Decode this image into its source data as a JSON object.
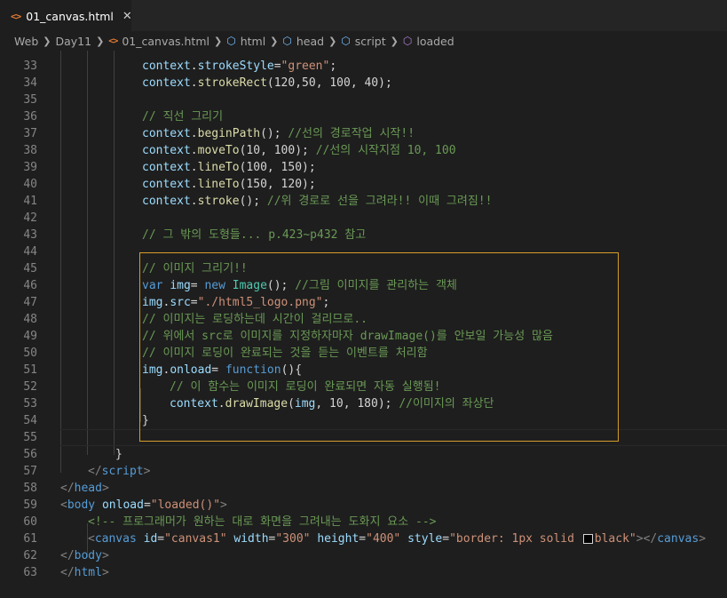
{
  "tab": {
    "icon": "<>",
    "label": "01_canvas.html",
    "close": "✕"
  },
  "breadcrumb": {
    "items": [
      {
        "label": "Web",
        "icon": ""
      },
      {
        "label": "Day11",
        "icon": ""
      },
      {
        "label": "01_canvas.html",
        "icon": "html-icon"
      },
      {
        "label": "html",
        "icon": "cube-icon"
      },
      {
        "label": "head",
        "icon": "cube-icon"
      },
      {
        "label": "script",
        "icon": "cube-icon"
      },
      {
        "label": "loaded",
        "icon": "purple-cube-icon"
      }
    ]
  },
  "editor": {
    "line_numbers": [
      "33",
      "34",
      "35",
      "36",
      "37",
      "38",
      "39",
      "40",
      "41",
      "42",
      "43",
      "44",
      "45",
      "46",
      "47",
      "48",
      "49",
      "50",
      "51",
      "52",
      "53",
      "54",
      "55",
      "56",
      "57",
      "58",
      "59",
      "60",
      "61",
      "62",
      "63"
    ],
    "lines": {
      "l33": [
        "context",
        ".",
        "strokeStyle",
        "=",
        "\"green\"",
        ";"
      ],
      "l34": [
        "context",
        ".",
        "strokeRect",
        "(120,50, 100, 40);"
      ],
      "l36": "// 직선 그리기",
      "l37": [
        "context",
        ".",
        "beginPath",
        "(); ",
        "//선의 경로작업 시작!!"
      ],
      "l38": [
        "context",
        ".",
        "moveTo",
        "(10, 100); ",
        "//선의 시작지점 10, 100"
      ],
      "l39": [
        "context",
        ".",
        "lineTo",
        "(100, 150);"
      ],
      "l40": [
        "context",
        ".",
        "lineTo",
        "(150, 120);"
      ],
      "l41": [
        "context",
        ".",
        "stroke",
        "(); ",
        "//위 경로로 선을 그려라!! 이때 그려짐!!"
      ],
      "l43": "// 그 밖의 도형들... p.423~p432 참고",
      "l45": "// 이미지 그리기!!",
      "l46": [
        "var",
        " ",
        "img",
        "= ",
        "new",
        " ",
        "Image",
        "(); ",
        "//그림 이미지를 관리하는 객체"
      ],
      "l47": [
        "img",
        ".",
        "src",
        "=",
        "\"./html5_logo.png\"",
        ";"
      ],
      "l48": "// 이미지는 로딩하는데 시간이 걸리므로..",
      "l49": "// 위에서 src로 이미지를 지정하자마자 drawImage()를 안보일 가능성 많음",
      "l50": "// 이미지 로딩이 완료되는 것을 듣는 이벤트를 처리함",
      "l51": [
        "img",
        ".",
        "onload",
        "= ",
        "function",
        "(){"
      ],
      "l52": "// 이 함수는 이미지 로딩이 완료되면 자동 실행됨!",
      "l53": [
        "context",
        ".",
        "drawImage",
        "(",
        "img",
        ", 10, 180); ",
        "//이미지의 좌상단"
      ],
      "l54": "}",
      "l56": "}",
      "l57": [
        "</",
        "script",
        ">"
      ],
      "l58": [
        "</",
        "head",
        ">"
      ],
      "l59": [
        "<",
        "body",
        " ",
        "onload",
        "=",
        "\"loaded()\"",
        ">"
      ],
      "l60": "<!-- 프로그래머가 원하는 대로 화면을 그려내는 도화지 요소 -->",
      "l61": [
        "<",
        "canvas",
        " ",
        "id",
        "=",
        "\"canvas1\"",
        " ",
        "width",
        "=",
        "\"300\"",
        " ",
        "height",
        "=",
        "\"400\"",
        " ",
        "style",
        "=",
        "\"border: 1px solid ",
        "black\"",
        "></",
        "canvas",
        ">"
      ],
      "l62": [
        "</",
        "body",
        ">"
      ],
      "l63": [
        "</",
        "html",
        ">"
      ]
    }
  },
  "colors": {
    "accent": "#d69c2a",
    "tab_icon": "#e37933",
    "swatch": "#000000"
  }
}
